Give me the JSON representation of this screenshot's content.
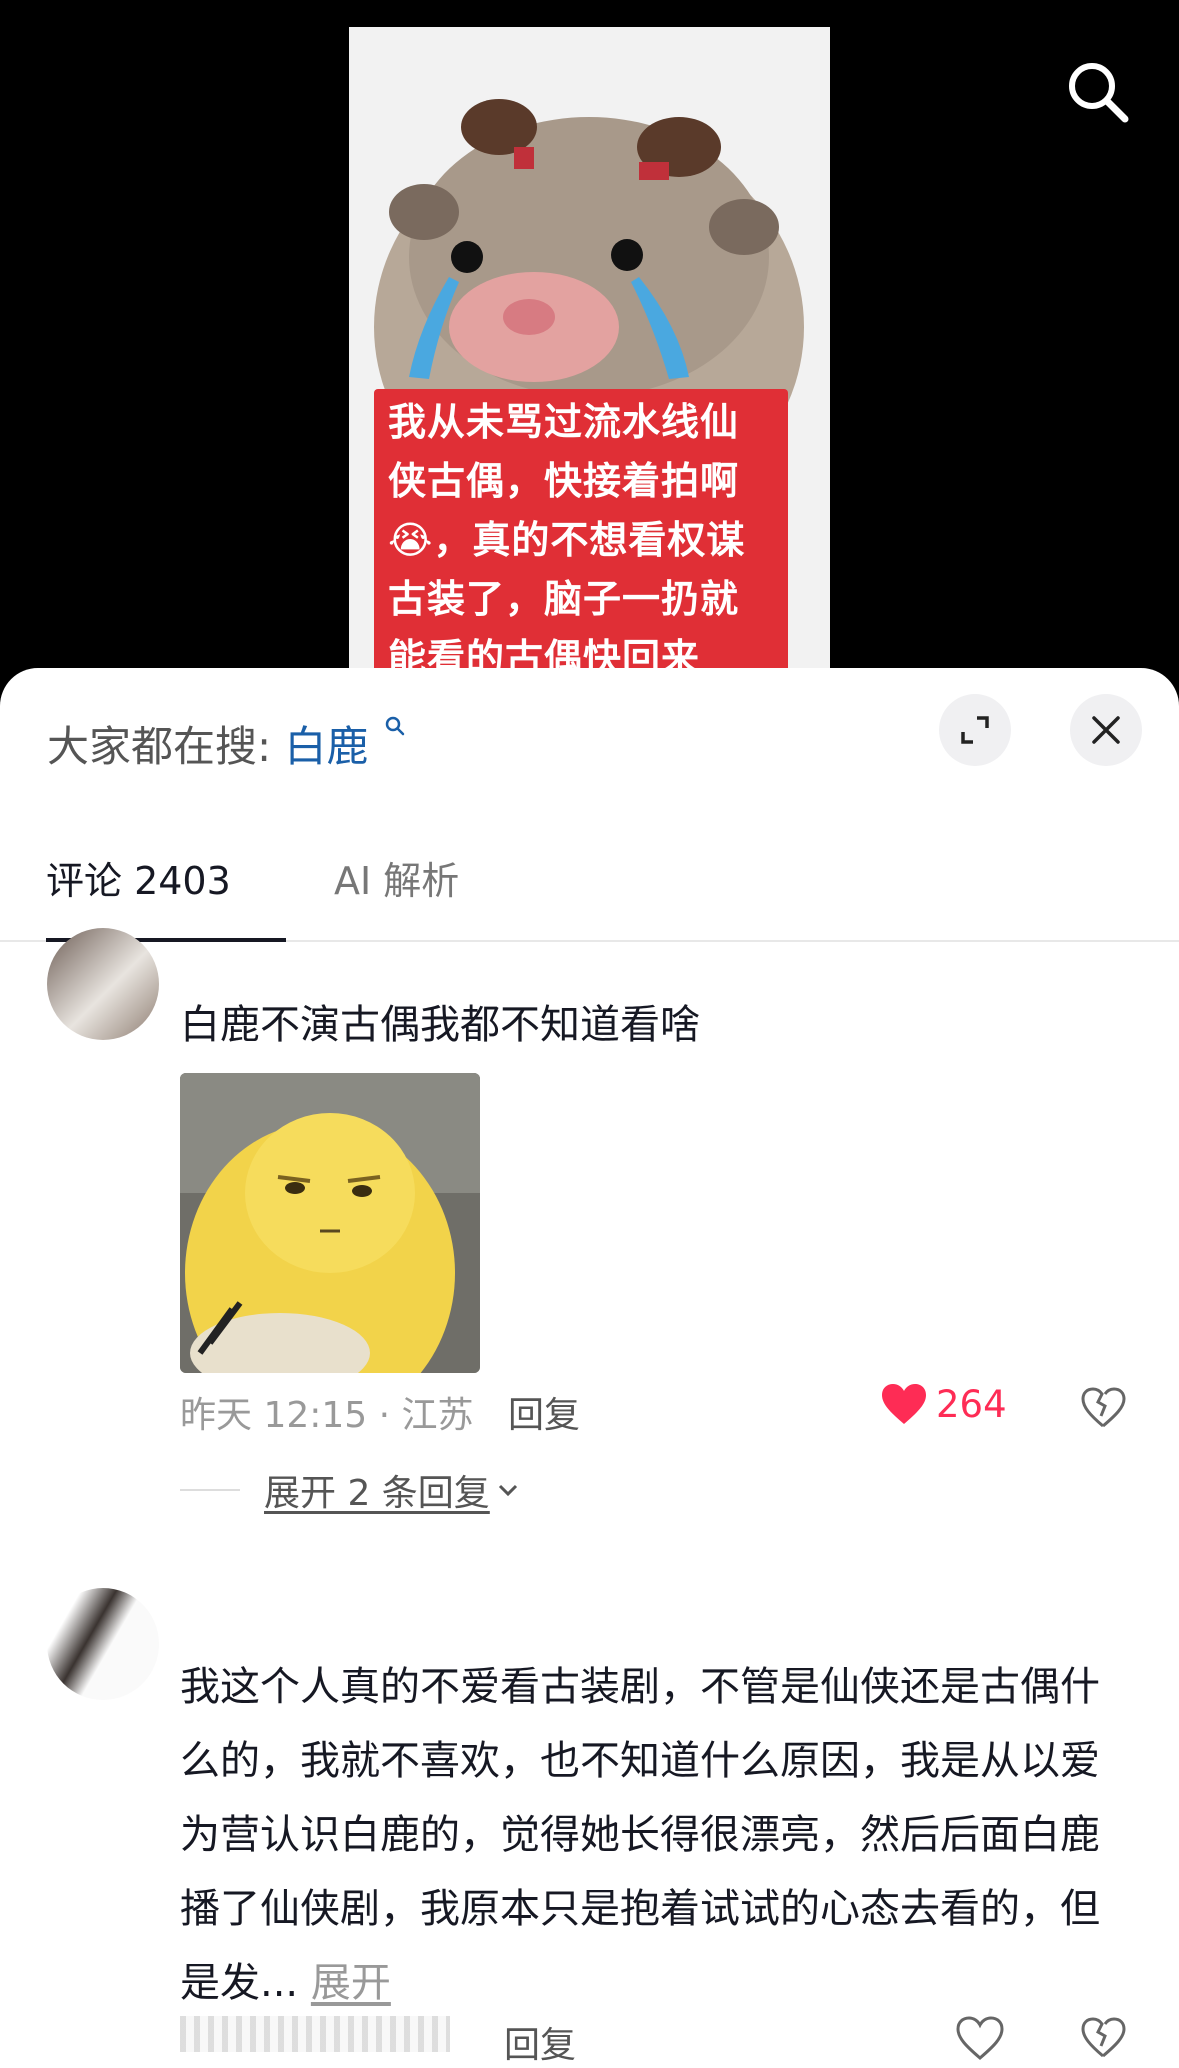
{
  "video": {
    "caption": "我从未骂过流水线仙侠古偶，快接着拍啊😭，真的不想看权谋古装了，脑子一扔就能看的古偶快回来"
  },
  "sheet": {
    "hot_search_label": "大家都在搜:",
    "hot_search_keyword": "白鹿"
  },
  "tabs": [
    {
      "label": "评论 2403"
    },
    {
      "label": "AI 解析"
    }
  ],
  "comments": [
    {
      "text": "白鹿不演古偶我都不知道看啥",
      "meta": "昨天 12:15 · 江苏",
      "reply_label": "回复",
      "likes": "264",
      "liked": true,
      "expand_replies": "展开 2 条回复"
    },
    {
      "text": "我这个人真的不爱看古装剧，不管是仙侠还是古偶什么的，我就不喜欢，也不知道什么原因，我是从以爱为营认识白鹿的，觉得她长得很漂亮，然后后面白鹿播了仙侠剧，我原本只是抱着试试的心态去看的，但是发...",
      "more_label": "展开",
      "reply_label": "回复"
    }
  ],
  "colors": {
    "accent": "#fe2c55",
    "keyword": "#1a5fa8",
    "caption_bg": "#e02f36"
  }
}
